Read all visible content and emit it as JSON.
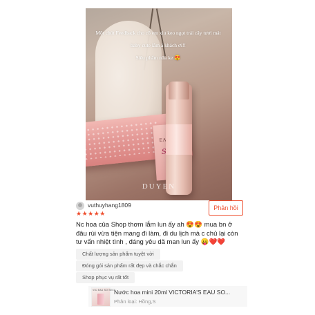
{
  "photo": {
    "caption_line1": "Một chút Feedback cho cô em xiu kẹo ngọt trái cây tươi mát",
    "caption_line2": "baby cute lắm á khách ơi!!",
    "caption_line3": "Siêu phẩm nữa ke 😍",
    "box_label": "EAU SO",
    "box_script": "sexy",
    "watermark": "DUYEN"
  },
  "review": {
    "username": "vuthuyhang1809",
    "rating": 5,
    "stars": "★★★★★",
    "reply_label": "Phản hồi",
    "text_lines": [
      "Nc hoa của Shop thơm lắm lun ấy ah 😍😍 mua bn ở",
      "đâu rùi vừa tiện mang đi làm, đi du lịch mà c chủ lại còn",
      "tư vấn nhiệt tình , đáng yêu dã man lun ấy 😛❤️❤️"
    ],
    "tags": [
      "Chất lượng sản phẩm tuyệt vời",
      "Đóng gói sản phẩm rất đẹp và chắc chắn",
      "Shop phục vụ rất tốt"
    ]
  },
  "product": {
    "thumb_label": "VIC EAU SO SEXY",
    "name": "Nước hoa mini 20ml VICTORIA'S EAU SO...",
    "variant": "Phân loại: Hồng,S"
  },
  "colors": {
    "accent": "#ee4d2d",
    "tag_bg": "#f2f2f2",
    "product_bg": "#f7f7f7"
  }
}
